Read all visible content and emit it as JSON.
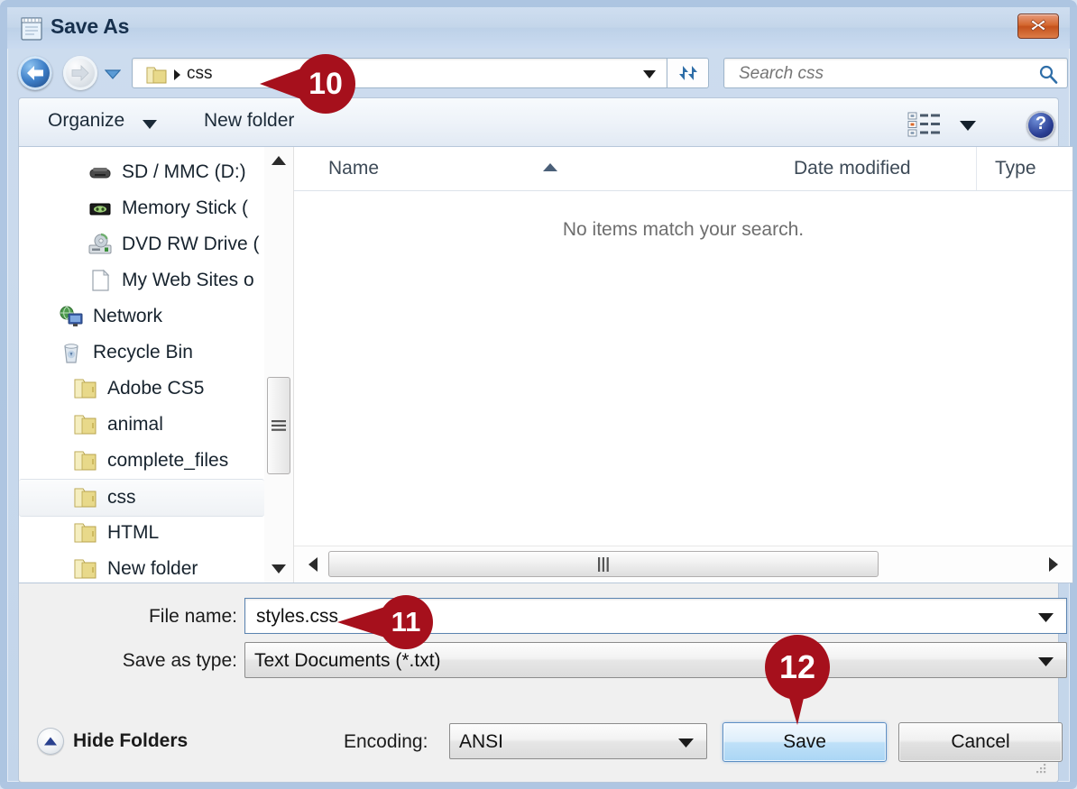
{
  "window": {
    "title": "Save As",
    "app_icon": "notepad-icon",
    "close_label": "Close",
    "accent_blue": "#5b84b1",
    "callout_red": "#a6101c",
    "frame_blue": "#a8c0de"
  },
  "nav": {
    "back_label": "Back",
    "forward_label": "Forward",
    "history_label": "Recent pages",
    "refresh_label": "Refresh",
    "breadcrumb": {
      "folder_icon": "folder-icon",
      "separator": "▸",
      "current": "css"
    }
  },
  "search": {
    "placeholder": "Search css",
    "value": "",
    "icon": "search-icon"
  },
  "commandbar": {
    "organize": "Organize",
    "new_folder": "New folder",
    "view_mode_icon": "view-mode-icon",
    "help_glyph": "?",
    "help_label": "Help"
  },
  "sidebar": {
    "items": [
      {
        "label": "SD / MMC (D:)",
        "icon": "sd-card-drive-icon",
        "indent": 76,
        "selected": false
      },
      {
        "label": "Memory Stick (",
        "icon": "memory-stick-drive-icon",
        "indent": 76,
        "selected": false
      },
      {
        "label": "DVD RW Drive (",
        "icon": "dvd-drive-icon",
        "indent": 76,
        "selected": false
      },
      {
        "label": "My Web Sites o",
        "icon": "document-icon",
        "indent": 76,
        "selected": false
      },
      {
        "label": "Network",
        "icon": "network-icon",
        "indent": 44,
        "selected": false
      },
      {
        "label": "Recycle Bin",
        "icon": "recycle-bin-icon",
        "indent": 44,
        "selected": false
      },
      {
        "label": "Adobe CS5",
        "icon": "folder-icon",
        "indent": 60,
        "selected": false
      },
      {
        "label": "animal",
        "icon": "folder-icon",
        "indent": 60,
        "selected": false
      },
      {
        "label": "complete_files",
        "icon": "folder-icon",
        "indent": 60,
        "selected": false
      },
      {
        "label": "css",
        "icon": "folder-icon",
        "indent": 60,
        "selected": true
      },
      {
        "label": "HTML",
        "icon": "folder-icon",
        "indent": 60,
        "selected": false
      },
      {
        "label": "New folder",
        "icon": "folder-icon",
        "indent": 60,
        "selected": false
      }
    ],
    "scrollbar": {
      "up_label": "Scroll up",
      "down_label": "Scroll down"
    }
  },
  "filelist": {
    "columns": [
      {
        "key": "name",
        "label": "Name",
        "sorted": "ascending"
      },
      {
        "key": "date",
        "label": "Date modified",
        "sorted": ""
      },
      {
        "key": "type",
        "label": "Type",
        "sorted": ""
      }
    ],
    "rows": [],
    "empty_message": "No items match your search.",
    "hscroll": {
      "left_label": "Scroll left",
      "right_label": "Scroll right"
    }
  },
  "form": {
    "filename_label": "File name:",
    "filename_value": "styles.css",
    "savetype_label": "Save as type:",
    "savetype_value": "Text Documents (*.txt)"
  },
  "footer": {
    "hide_folders_label": "Hide Folders",
    "encoding_label": "Encoding:",
    "encoding_value": "ANSI",
    "save_label": "Save",
    "cancel_label": "Cancel"
  },
  "callouts": [
    {
      "number": "10",
      "points": "left",
      "target": "address-bar-breadcrumb"
    },
    {
      "number": "11",
      "points": "left",
      "target": "file-name-input"
    },
    {
      "number": "12",
      "points": "down",
      "target": "save-button"
    }
  ]
}
